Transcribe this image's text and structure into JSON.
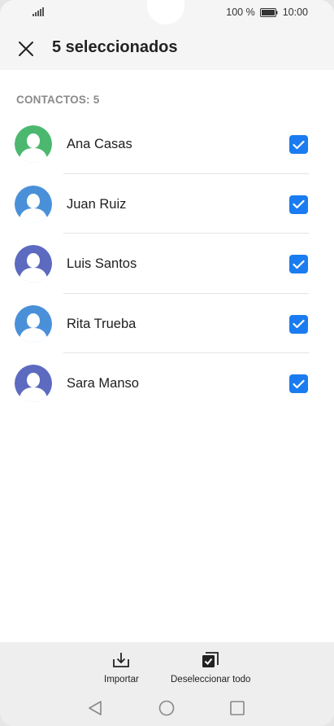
{
  "status_bar": {
    "battery": "100 %",
    "time": "10:00"
  },
  "app_bar": {
    "title": "5 seleccionados"
  },
  "contacts": {
    "header": "CONTACTOS: 5",
    "items": [
      {
        "name": "Ana Casas",
        "avatar_color": "#4cb86f",
        "checked": true
      },
      {
        "name": "Juan Ruiz",
        "avatar_color": "#4a90d9",
        "checked": true
      },
      {
        "name": "Luis Santos",
        "avatar_color": "#5c6bc0",
        "checked": true
      },
      {
        "name": "Rita Trueba",
        "avatar_color": "#4a90d9",
        "checked": true
      },
      {
        "name": "Sara Manso",
        "avatar_color": "#5c6bc0",
        "checked": true
      }
    ]
  },
  "actions": {
    "import_label": "Importar",
    "deselect_label": "Deseleccionar todo"
  },
  "colors": {
    "accent": "#1a7cf0"
  }
}
